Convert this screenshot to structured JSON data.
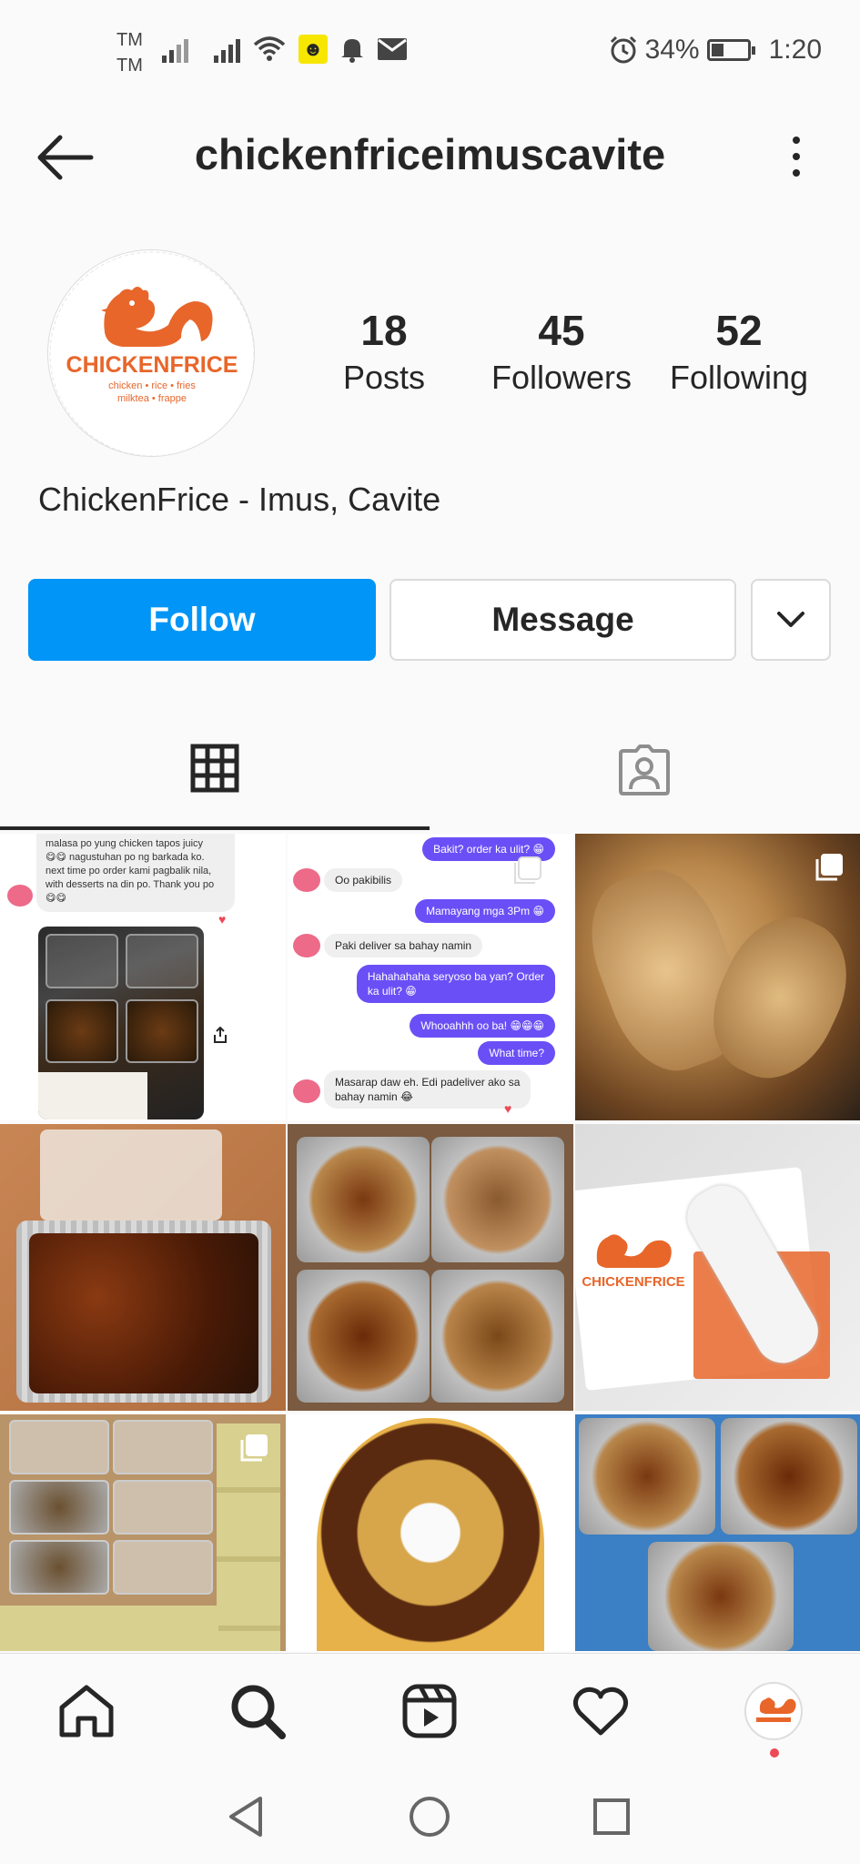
{
  "status_bar": {
    "carrier_1": "TM",
    "carrier_2": "TM",
    "battery": "34%",
    "time": "1:20"
  },
  "header": {
    "username": "chickenfriceimuscavite"
  },
  "profile": {
    "avatar_logo_text": "CHICKENFRICE",
    "avatar_logo_sub1": "chicken • rice • fries",
    "avatar_logo_sub2": "milktea • frappe",
    "stats": [
      {
        "value": "18",
        "label": "Posts"
      },
      {
        "value": "45",
        "label": "Followers"
      },
      {
        "value": "52",
        "label": "Following"
      }
    ],
    "display_name": "ChickenFrice - Imus, Cavite"
  },
  "actions": {
    "follow_label": "Follow",
    "message_label": "Message"
  },
  "colors": {
    "follow_blue": "#0095f6",
    "brand_orange": "#e8662a",
    "chat_purple": "#6b4ff6",
    "notification_red": "#ed4956"
  },
  "posts": {
    "post1": {
      "review_lines": [
        "malasa po yung chicken tapos juicy",
        "😋😋 nagustuhan po ng barkada ko.",
        "next time po order kami pagbalik nila,",
        "with desserts na din po. Thank you po",
        "😋😋"
      ]
    },
    "post2": {
      "messages": [
        {
          "dir": "out",
          "text": "Bakit? order ka ulit? 😁"
        },
        {
          "dir": "in",
          "text": "Oo pakibilis"
        },
        {
          "dir": "out",
          "text": "Mamayang mga 3Pm 😁"
        },
        {
          "dir": "in",
          "text": "Paki deliver sa bahay namin"
        },
        {
          "dir": "out",
          "text": "Hahahahaha seryoso ba yan? Order"
        },
        {
          "dir": "out",
          "text": "ka ulit? 😁"
        },
        {
          "dir": "out",
          "text": "Whooahhh oo ba! 😁😁😁"
        },
        {
          "dir": "out",
          "text": "What time?"
        },
        {
          "dir": "in",
          "text": "Masarap daw eh. Edi padeliver ako sa"
        },
        {
          "dir": "in",
          "text": "bahay namin 😂"
        }
      ]
    },
    "post6_logo": "CHICKENFRICE"
  },
  "icons": {
    "back": "arrow-left-icon",
    "more": "more-vertical-icon",
    "dropdown": "chevron-down-icon",
    "grid": "grid-icon",
    "tagged": "person-tag-icon",
    "home": "home-icon",
    "search": "search-icon",
    "reels": "reels-icon",
    "activity": "heart-icon"
  }
}
